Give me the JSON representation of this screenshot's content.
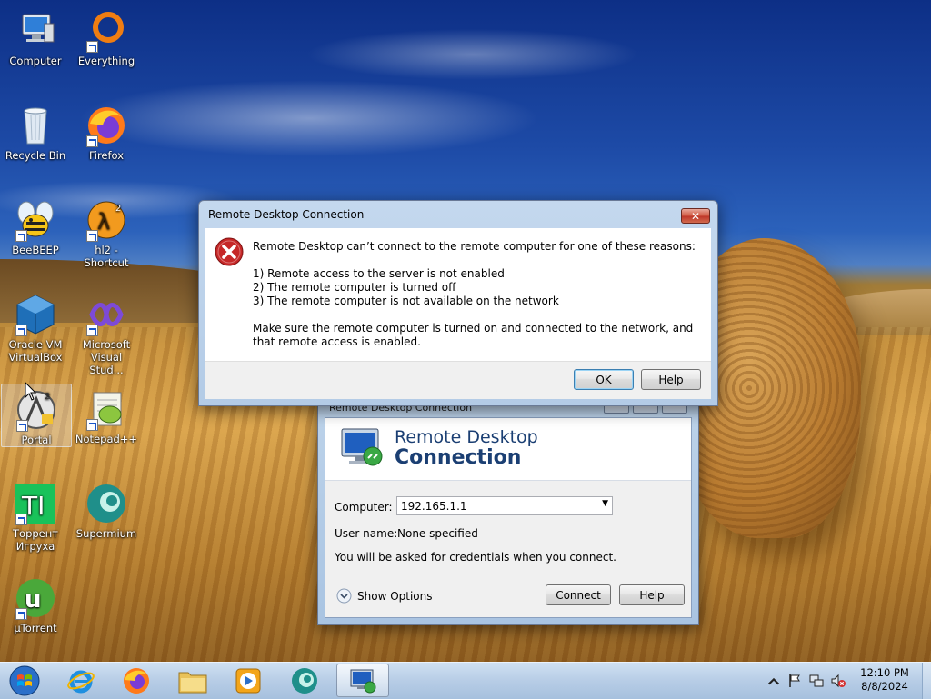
{
  "desktop": {
    "icons": [
      {
        "label": "Computer",
        "icon": "computer-icon"
      },
      {
        "label": "Everything",
        "icon": "everything-icon"
      },
      {
        "label": "Recycle Bin",
        "icon": "recycle-bin-icon"
      },
      {
        "label": "Firefox",
        "icon": "firefox-icon"
      },
      {
        "label": "BeeBEEP",
        "icon": "beebeep-icon"
      },
      {
        "label": "hl2 - Shortcut",
        "icon": "half-life-2-icon"
      },
      {
        "label": "Oracle VM VirtualBox",
        "icon": "virtualbox-icon"
      },
      {
        "label": "Microsoft Visual Stud...",
        "icon": "visual-studio-icon"
      },
      {
        "label": "Portal",
        "icon": "portal-icon"
      },
      {
        "label": "Notepad++",
        "icon": "notepad-plus-plus-icon"
      },
      {
        "label": "Торрент Игруха",
        "icon": "torrent-igruha-icon"
      },
      {
        "label": "Supermium",
        "icon": "supermium-icon"
      },
      {
        "label": "µTorrent",
        "icon": "utorrent-icon"
      }
    ]
  },
  "rdc_window": {
    "title": "Remote Desktop Connection",
    "brand_line1": "Remote Desktop",
    "brand_line2": "Connection",
    "computer_label": "Computer:",
    "computer_value": "192.165.1.1",
    "username_label": "User name:",
    "username_value": "None specified",
    "credentials_note": "You will be asked for credentials when you connect.",
    "show_options": "Show Options",
    "connect_button": "Connect",
    "help_button": "Help"
  },
  "error_dialog": {
    "title": "Remote Desktop Connection",
    "close_glyph": "✕",
    "intro": "Remote Desktop can’t connect to the remote computer for one of these reasons:",
    "reasons": [
      "1) Remote access to the server is not enabled",
      "2) The remote computer is turned off",
      "3) The remote computer is not available on the network"
    ],
    "advice": "Make sure the remote computer is turned on and connected to the network, and that remote access is enabled.",
    "ok_button": "OK",
    "help_button": "Help"
  },
  "taskbar": {
    "pinned": [
      {
        "name": "start-button",
        "icon": "windows-logo-icon"
      },
      {
        "name": "internet-explorer",
        "icon": "internet-explorer-icon"
      },
      {
        "name": "firefox",
        "icon": "firefox-icon"
      },
      {
        "name": "windows-explorer",
        "icon": "folder-icon"
      },
      {
        "name": "windows-media-player",
        "icon": "media-player-icon"
      },
      {
        "name": "supermium",
        "icon": "supermium-icon"
      },
      {
        "name": "remote-desktop-connection",
        "icon": "remote-desktop-icon",
        "active": true
      }
    ],
    "tray": {
      "icons": [
        "show-hidden-icons-arrow",
        "action-center-flag-icon",
        "network-icon",
        "volume-muted-icon"
      ],
      "time": "12:10 PM",
      "date": "8/8/2024"
    }
  },
  "colors": {
    "brand_text": "#1b3f73",
    "error_red": "#c62828",
    "taskbar": "#b7cde6"
  }
}
